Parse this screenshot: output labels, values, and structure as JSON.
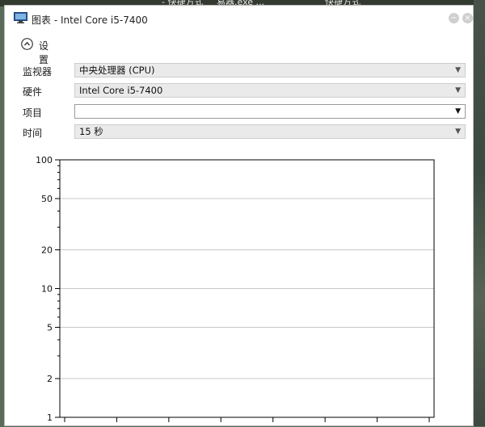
{
  "background": {
    "items": [
      "- 快捷方式",
      "易器.exe ...",
      "快捷方式"
    ]
  },
  "window": {
    "title": "图表 - Intel Core i5-7400",
    "minimize_label": "−",
    "close_label": "×"
  },
  "settings": {
    "label": "设置",
    "fields": [
      {
        "label": "监视器",
        "value": "中央处理器 (CPU)"
      },
      {
        "label": "硬件",
        "value": "Intel Core i5-7400"
      },
      {
        "label": "项目",
        "value": ""
      },
      {
        "label": "时间",
        "value": "15 秒"
      }
    ]
  },
  "chart_data": {
    "type": "line",
    "scale": "log",
    "ylim": [
      1,
      100
    ],
    "y_ticks": [
      1,
      2,
      5,
      10,
      20,
      50,
      100
    ],
    "grid": true,
    "x_tick_count": 8,
    "series": []
  },
  "colors": {
    "grid": "#c8c8c8",
    "axis": "#000000",
    "window_bg": "#ffffff"
  }
}
